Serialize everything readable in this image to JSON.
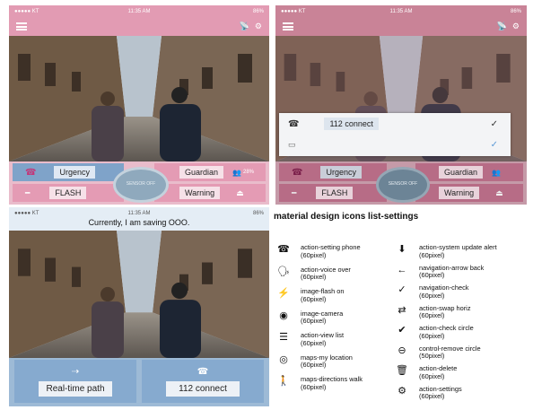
{
  "panel1": {
    "status": {
      "carrier": "●●●●● KT",
      "time": "11:35 AM",
      "battery": "86%"
    },
    "buttons": {
      "urgency": "Urgency",
      "guardian": "Guardian",
      "flash": "FLASH",
      "warning": "Warning"
    },
    "center_button": "SENSOR OFF",
    "guardian_count": "28%"
  },
  "panel2": {
    "status": {
      "carrier": "●●●●● KT",
      "time": "11:35 AM",
      "battery": "86%"
    },
    "dialog": {
      "call_label": "112 connect"
    },
    "buttons": {
      "urgency": "Urgency",
      "guardian": "Guardian",
      "flash": "FLASH",
      "warning": "Warning"
    },
    "center_button": "SENSOR OFF"
  },
  "panel3": {
    "status": {
      "carrier": "●●●●● KT",
      "time": "11:35 AM",
      "battery": "86%"
    },
    "banner": "Currently, I am saving OOO.",
    "buttons": {
      "realtime": "Real-time path",
      "connect": "112 connect"
    }
  },
  "panel4": {
    "title": "material design icons list-settings",
    "left": [
      {
        "icon": "phone-settings-icon",
        "glyph": "☎",
        "name": "action-setting phone",
        "size": "(60pixel)"
      },
      {
        "icon": "voice-over-icon",
        "glyph": "🗣",
        "name": "action-voice over",
        "size": "(60pixel)"
      },
      {
        "icon": "flash-icon",
        "glyph": "⚡",
        "name": "image-flash on",
        "size": "(60pixel)"
      },
      {
        "icon": "camera-icon",
        "glyph": "◉",
        "name": "image-camera",
        "size": "(60pixel)"
      },
      {
        "icon": "view-list-icon",
        "glyph": "☰",
        "name": "action-view list",
        "size": "(60pixel)"
      },
      {
        "icon": "location-icon",
        "glyph": "◎",
        "name": "maps-my location",
        "size": "(60pixel)"
      },
      {
        "icon": "walk-icon",
        "glyph": "🚶",
        "name": "maps-directions walk",
        "size": "(60pixel)"
      }
    ],
    "right": [
      {
        "icon": "system-update-icon",
        "glyph": "⬇",
        "name": "action-system update alert",
        "size": "(60pixel)"
      },
      {
        "icon": "arrow-back-icon",
        "glyph": "←",
        "name": "navigation-arrow back",
        "size": "(60pixel)"
      },
      {
        "icon": "check-icon",
        "glyph": "✓",
        "name": "navigation-check",
        "size": "(60pixel)"
      },
      {
        "icon": "swap-horiz-icon",
        "glyph": "⇄",
        "name": "action-swap horiz",
        "size": "(60pixel)"
      },
      {
        "icon": "check-circle-icon",
        "glyph": "✔",
        "name": "action-check circle",
        "size": "(60pixel)"
      },
      {
        "icon": "remove-circle-icon",
        "glyph": "⊖",
        "name": "control-remove circle",
        "size": "(50pixel)"
      },
      {
        "icon": "delete-icon",
        "glyph": "🗑",
        "name": "action-delete",
        "size": "(60pixel)"
      },
      {
        "icon": "settings-icon",
        "glyph": "⚙",
        "name": "action-settings",
        "size": "(60pixel)"
      }
    ]
  },
  "colors": {
    "pink": "#e9a8bd",
    "blue": "#7fa3c9",
    "bar": "#d29aab"
  }
}
